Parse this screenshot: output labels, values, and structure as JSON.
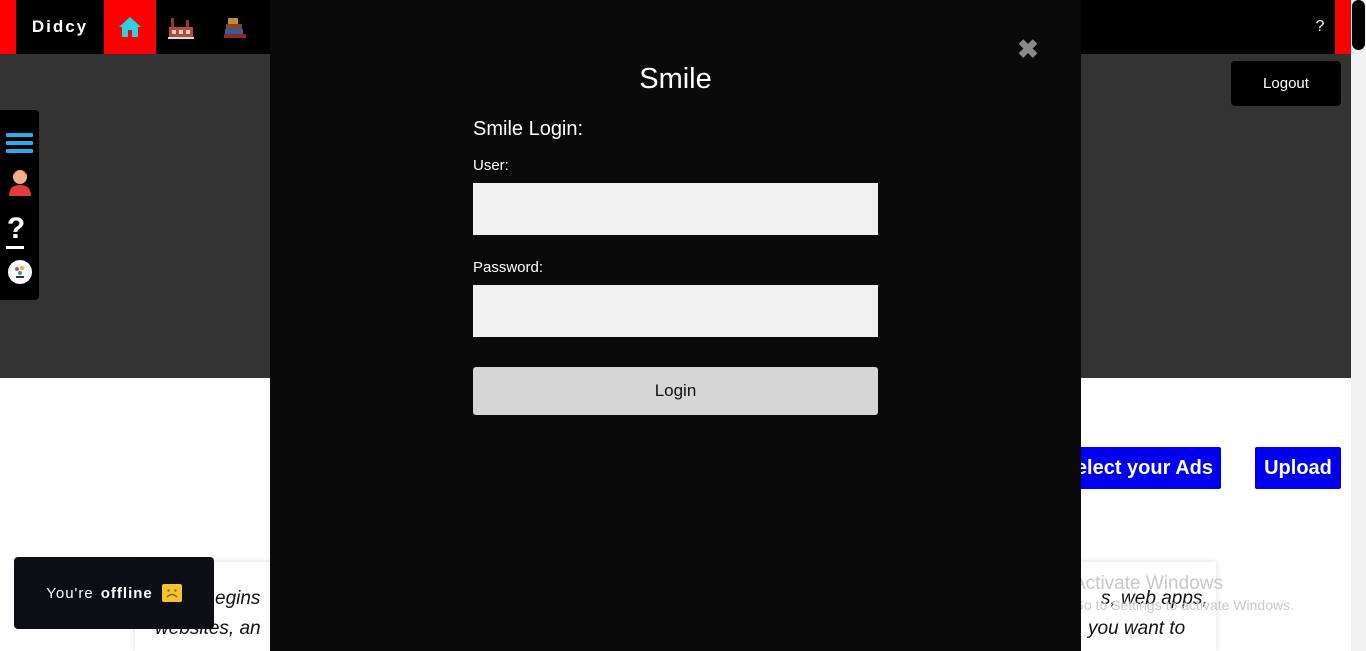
{
  "nav": {
    "brand": "Didcy",
    "help": "?",
    "icons": [
      "home-icon",
      "factory-icon",
      "books-icon"
    ]
  },
  "header": {
    "logout_label": "Logout"
  },
  "sidebar": {
    "icons": [
      "menu-icon",
      "user-avatar-icon",
      "help-icon",
      "logo-badge-icon"
    ],
    "help_glyph": "?"
  },
  "actions": {
    "select_ads_label": "elect your Ads",
    "upload_label": "Upload"
  },
  "content": {
    "line1_left": "egins",
    "line2_left": "websites, an",
    "line1_right": "s, web apps,",
    "line2_right": "you want to"
  },
  "watermark": {
    "title": "Activate Windows",
    "subtitle": "Go to Settings to activate Windows."
  },
  "toast": {
    "prefix": "You're",
    "status": "offline"
  },
  "modal": {
    "title": "Smile",
    "heading": "Smile Login:",
    "user_label": "User:",
    "user_value": "",
    "password_label": "Password:",
    "password_value": "",
    "login_label": "Login",
    "close_glyph": "✖"
  },
  "colors": {
    "accent_red": "#ff0000",
    "button_blue": "#0000ee",
    "hero_gray": "#333333",
    "home_icon": "#29d3e0"
  }
}
